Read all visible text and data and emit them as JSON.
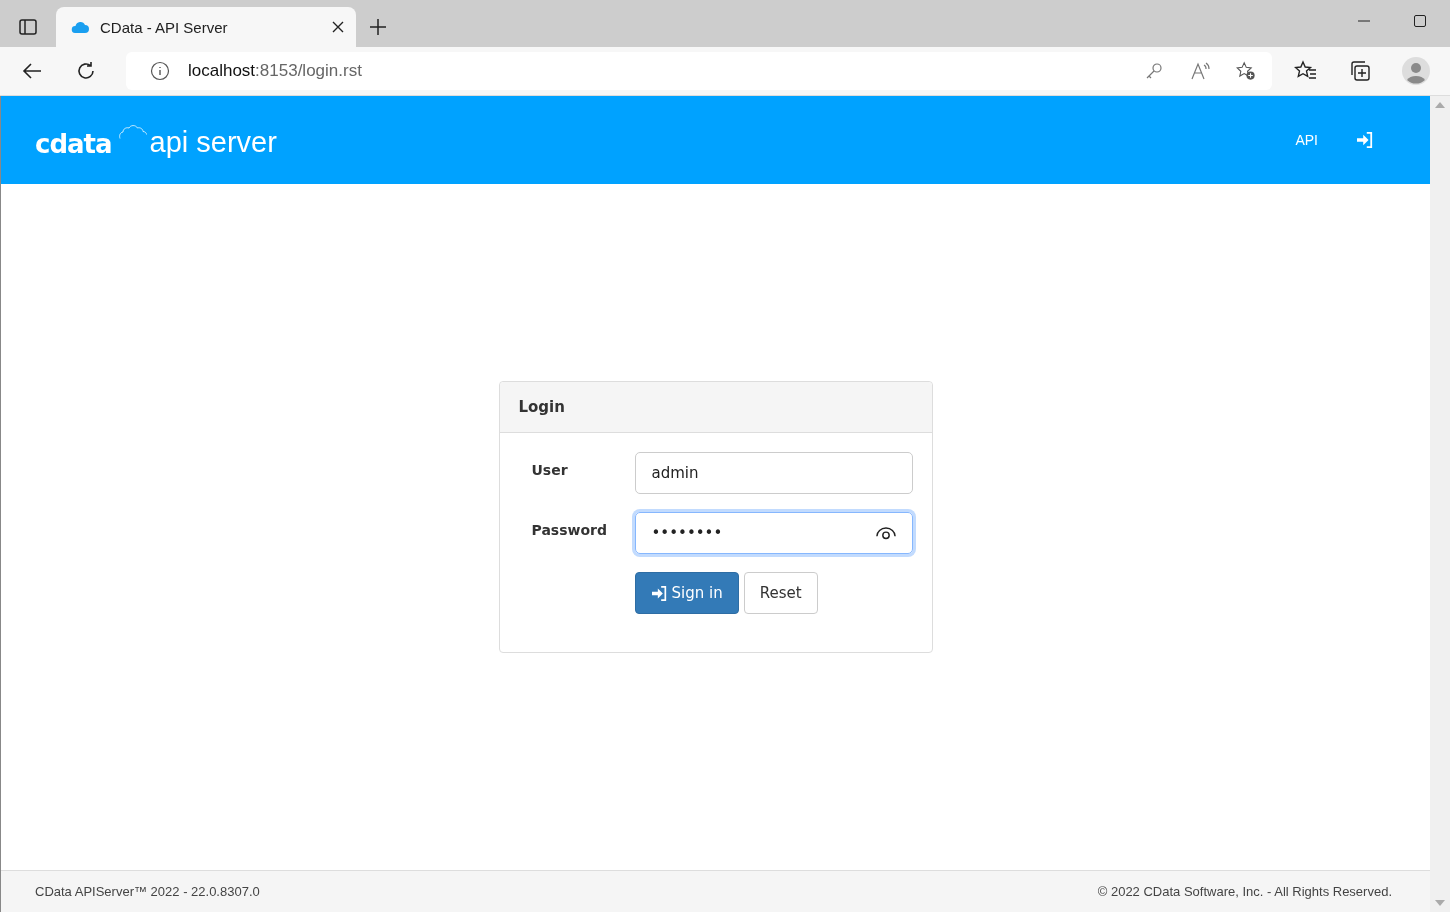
{
  "browser": {
    "tab_title": "CData - API Server",
    "url_host": "localhost",
    "url_path": ":8153/login.rst"
  },
  "header": {
    "logo_brand": "cdata",
    "logo_product": "api server",
    "nav": [
      {
        "label": "API"
      }
    ]
  },
  "login": {
    "title": "Login",
    "fields": [
      {
        "label": "User",
        "value": "admin",
        "focused": false,
        "reveal": false
      },
      {
        "label": "Password",
        "value": "••••••••",
        "focused": true,
        "reveal": true
      }
    ],
    "buttons": [
      {
        "label": "Sign in",
        "kind": "primary"
      },
      {
        "label": "Reset",
        "kind": "default"
      }
    ]
  },
  "footer": {
    "left": "CData APIServer™ 2022 - 22.0.8307.0",
    "right": "© 2022 CData Software, Inc. - All Rights Reserved."
  }
}
